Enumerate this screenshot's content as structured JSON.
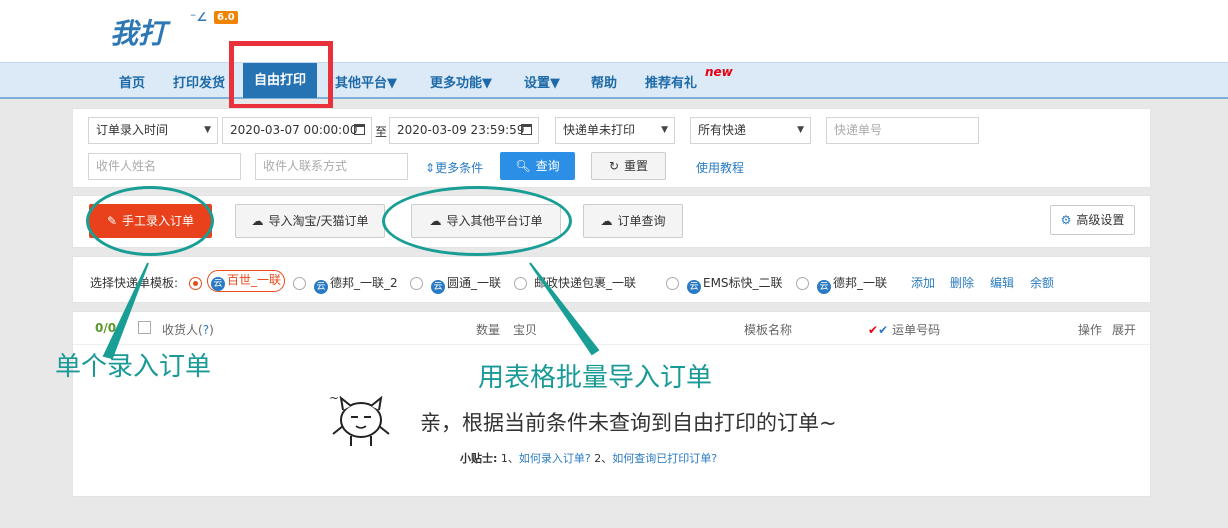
{
  "app": {
    "logo_text": "我打",
    "version": "6.0"
  },
  "nav": {
    "items": [
      {
        "label": "首页"
      },
      {
        "label": "打印发货"
      },
      {
        "label": "自由打印"
      },
      {
        "label": "其他平台▼"
      },
      {
        "label": "更多功能▼"
      },
      {
        "label": "设置▼"
      },
      {
        "label": "帮助"
      },
      {
        "label": "推荐有礼"
      }
    ],
    "badge": "new"
  },
  "filters": {
    "time_type": "订单录入时间",
    "start_time": "2020-03-07 00:00:00",
    "to_label": "至",
    "end_time": "2020-03-09 23:59:59",
    "print_status": "快递单未打印",
    "express": "所有快递",
    "tracking_placeholder": "快递单号",
    "receiver_name_placeholder": "收件人姓名",
    "receiver_contact_placeholder": "收件人联系方式",
    "more_conditions": "更多条件",
    "search_label": "查询",
    "reset_label": "重置",
    "tutorial_label": "使用教程"
  },
  "actions": {
    "manual_entry": "手工录入订单",
    "import_taobao": "导入淘宝/天猫订单",
    "import_other": "导入其他平台订单",
    "order_query": "订单查询",
    "advanced_settings": "高级设置"
  },
  "templates": {
    "label": "选择快递单模板:",
    "items": [
      "百世_一联",
      "德邦_一联_2",
      "圆通_一联",
      "邮政快递包裹_一联",
      "EMS标快_二联",
      "德邦_一联"
    ],
    "selected_index": 0,
    "links": [
      "添加",
      "删除",
      "编辑",
      "余额"
    ]
  },
  "table": {
    "count": "0/0",
    "consignee": "收货人(",
    "help_mark": "?",
    "consignee_close": ")",
    "quantity": "数量",
    "item": "宝贝",
    "template_name": "模板名称",
    "tracking": "运单号码",
    "operation": "操作",
    "expand": "展开"
  },
  "empty": {
    "message": "亲，根据当前条件未查询到自由打印的订单~",
    "tip_label": "小贴士:",
    "tip_1_num": "1、",
    "tip_1": "如何录入订单?",
    "tip_2_num": "2、",
    "tip_2": "如何查询已打印订单?"
  },
  "annotations": {
    "single": "单个录入订单",
    "batch": "用表格批量导入订单"
  },
  "colors": {
    "brand": "#2673b4",
    "accent": "#e8411b",
    "annotation": "#189e95",
    "highlight": "#e8313b"
  }
}
